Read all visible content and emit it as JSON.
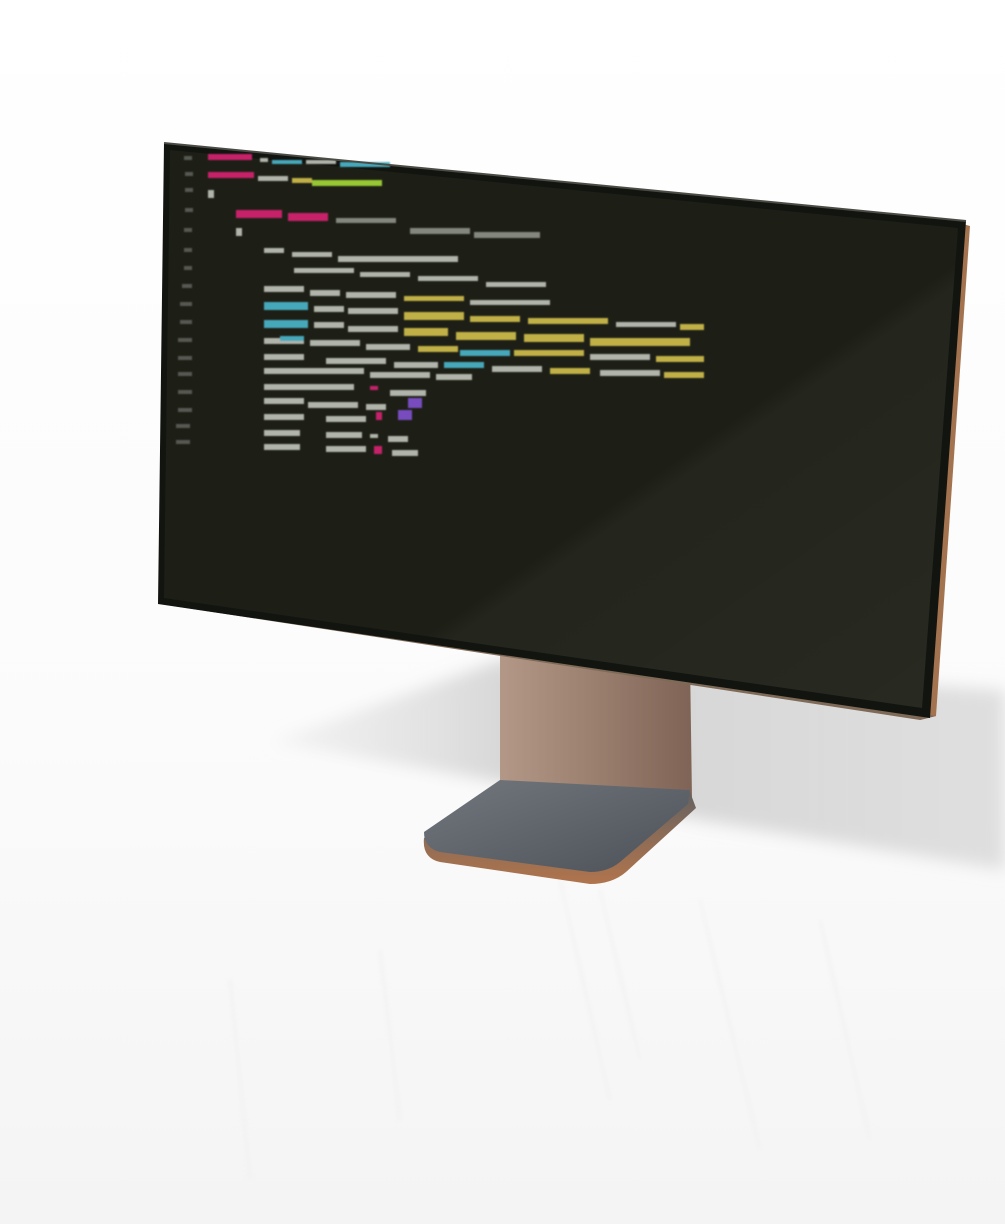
{
  "scene": {
    "subject": "monitor-on-stand",
    "colors": {
      "background": "#ffffff",
      "floor_shadow": "#cfcfcf",
      "bezel": "#121410",
      "screen": "#1d1f16",
      "frame_edge": "#a3734f",
      "stand_neck": "#9a7e6e",
      "stand_base_top": "#5f646b",
      "stand_base_edge": "#9b6a4b"
    },
    "code_colors": {
      "keyword": "#d0206e",
      "string": "#c9b84a",
      "type": "#4ab0c4",
      "text": "#b9bcb2",
      "green": "#9ed136",
      "purple": "#7d4fc7",
      "gutter": "#5a5c55"
    }
  }
}
